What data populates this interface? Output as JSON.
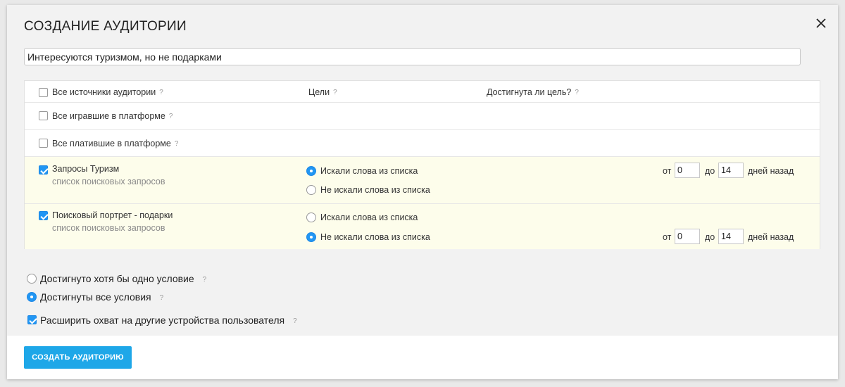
{
  "dialog": {
    "title": "СОЗДАНИЕ АУДИТОРИИ",
    "audience_name_value": "Интересуются туризмом, но не подарками"
  },
  "table": {
    "header": {
      "sources_label": "Все источники аудитории",
      "goals_label": "Цели",
      "reached_label": "Достигнута ли цель?",
      "help": "?"
    },
    "rows": [
      {
        "label": "Все игравшие в платформе",
        "help": "?",
        "checked": false
      },
      {
        "label": "Все платившие в платформе",
        "help": "?",
        "checked": false
      },
      {
        "label": "Запросы Туризм",
        "sublabel": "список поисковых запросов",
        "checked": true,
        "option_searched": "Искали слова из списка",
        "option_not_searched": "Не искали слова из списка",
        "selected": "searched",
        "from_label": "от",
        "from_value": "0",
        "to_label": "до",
        "to_value": "14",
        "days_label": "дней назад"
      },
      {
        "label": "Поисковый портрет - подарки",
        "sublabel": "список поисковых запросов",
        "checked": true,
        "option_searched": "Искали слова из списка",
        "option_not_searched": "Не искали слова из списка",
        "selected": "not_searched",
        "from_label": "от",
        "from_value": "0",
        "to_label": "до",
        "to_value": "14",
        "days_label": "дней назад"
      }
    ]
  },
  "conditions": {
    "any_label": "Достигнуто хотя бы одно условие",
    "all_label": "Достигнуты все условия",
    "selected": "all",
    "expand_label": "Расширить охват на другие устройства пользователя",
    "expand_checked": true,
    "help": "?"
  },
  "footer": {
    "create_button_label": "СОЗДАТЬ АУДИТОРИЮ"
  },
  "colors": {
    "accent": "#2196f3",
    "button": "#1ea7e8",
    "highlight_row": "#fdfdeb"
  }
}
